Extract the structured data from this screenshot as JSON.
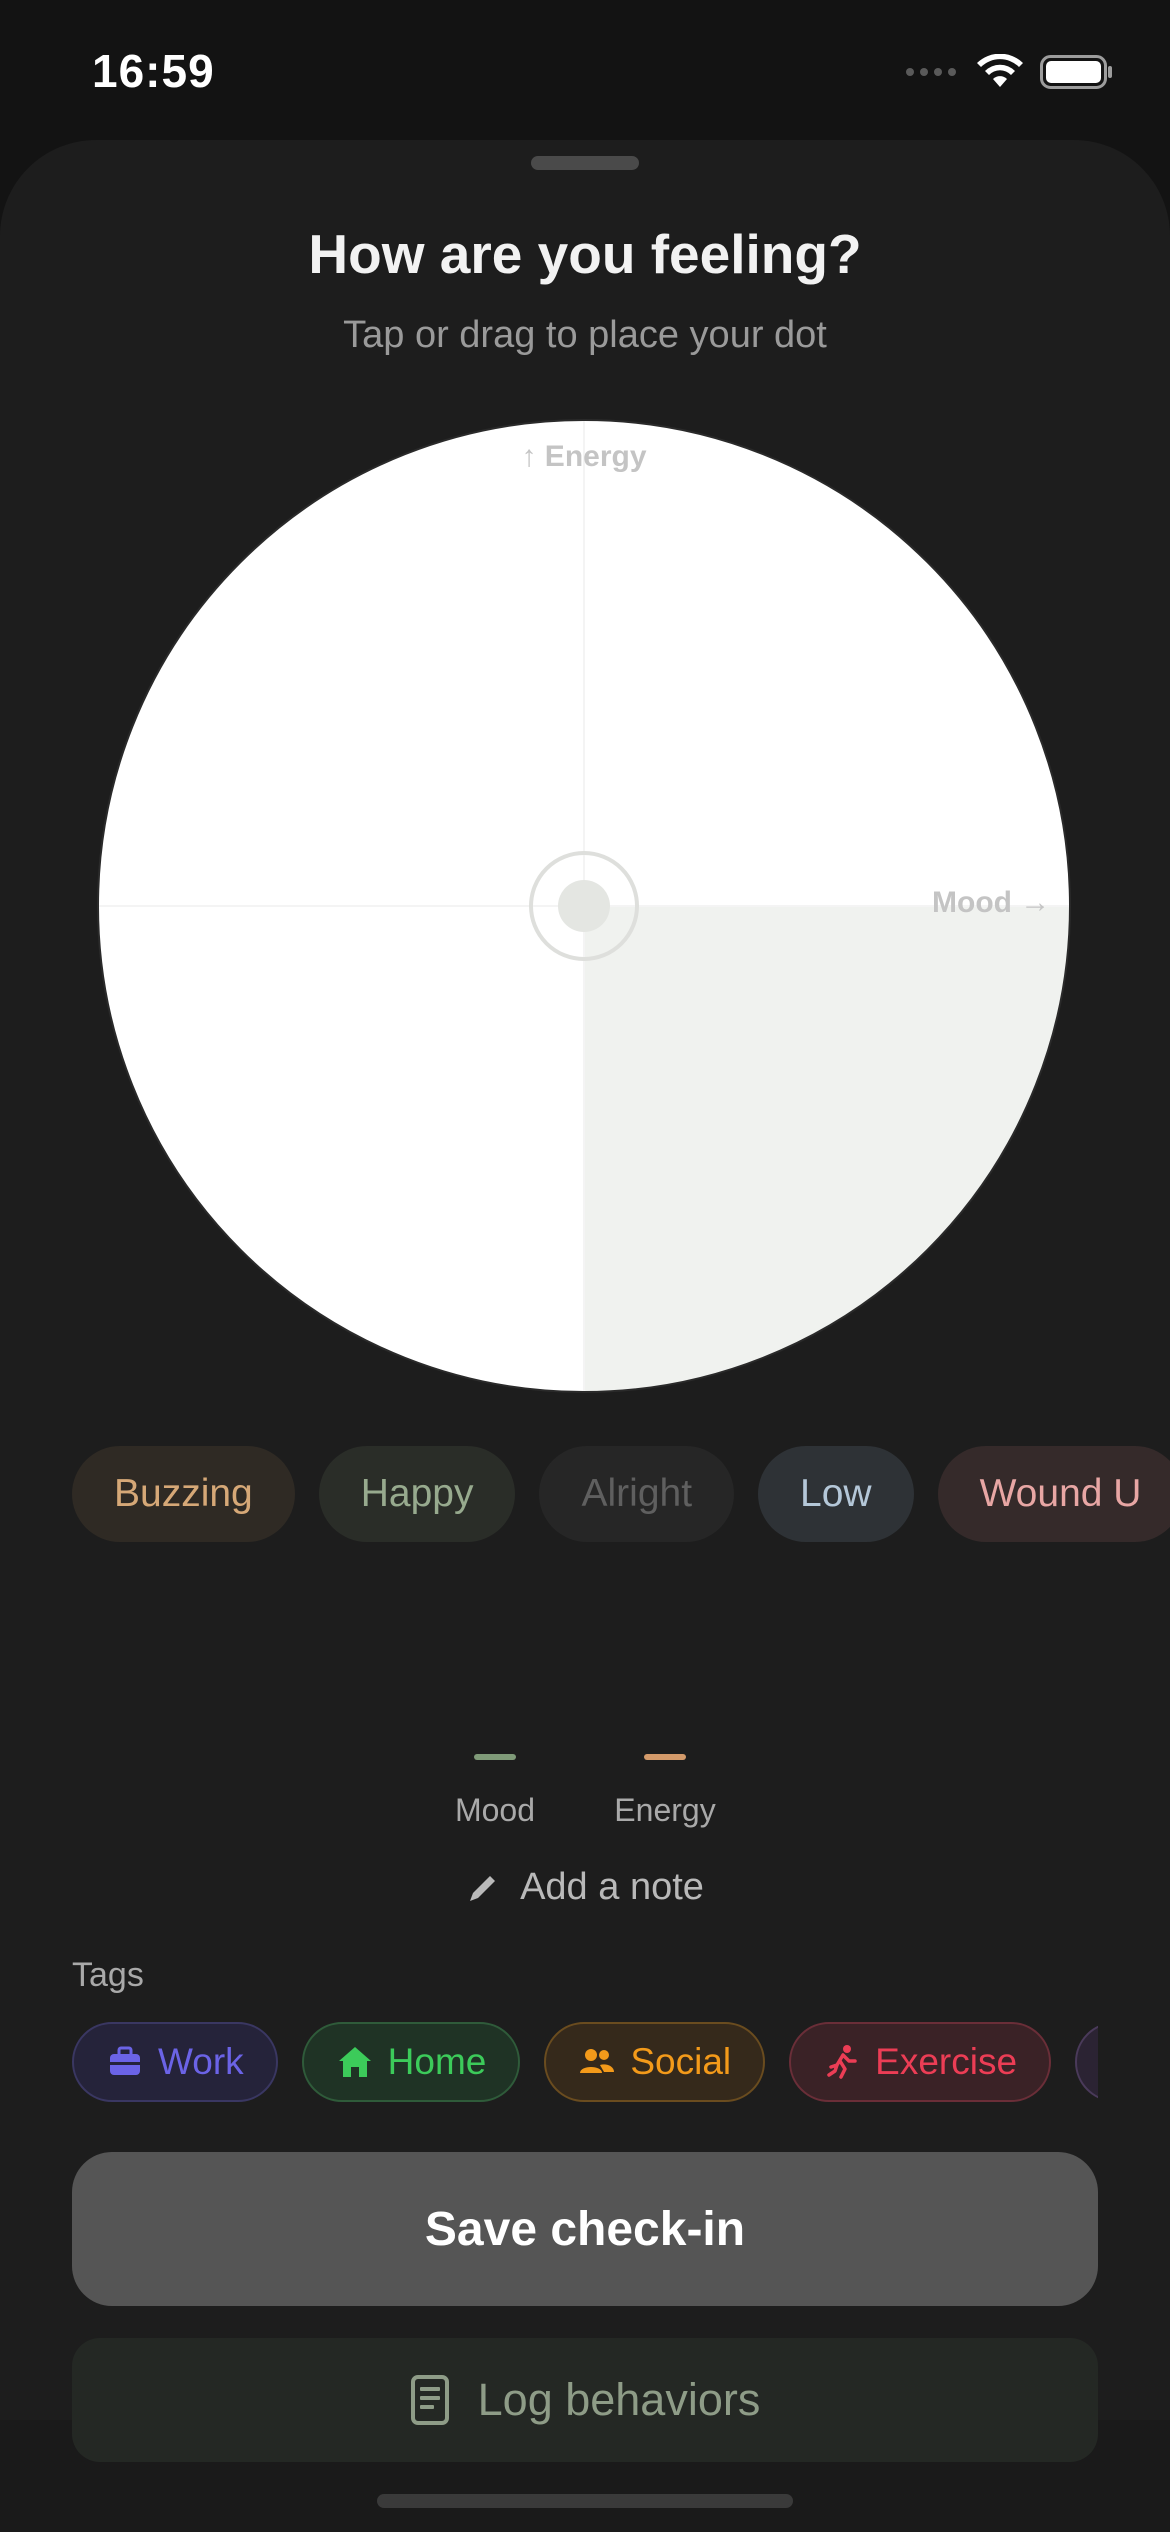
{
  "status_bar": {
    "time": "16:59"
  },
  "header": {
    "title": "How are you feeling?",
    "subtitle": "Tap or drag to place your dot"
  },
  "grid": {
    "energy_axis_label": "↑ Energy",
    "mood_axis_label": "Mood →"
  },
  "mood_chips": [
    {
      "label": "Buzzing"
    },
    {
      "label": "Happy"
    },
    {
      "label": "Alright"
    },
    {
      "label": "Low"
    },
    {
      "label": "Wound U"
    }
  ],
  "legend": {
    "mood_label": "Mood",
    "energy_label": "Energy",
    "mood_color": "#7f9a78",
    "energy_color": "#d39a6a"
  },
  "note": {
    "label": "Add a note"
  },
  "tags": {
    "title": "Tags",
    "items": [
      {
        "label": "Work",
        "icon": "briefcase-icon",
        "color": "#6b63e6"
      },
      {
        "label": "Home",
        "icon": "house-icon",
        "color": "#3ccb5a"
      },
      {
        "label": "Social",
        "icon": "people-icon",
        "color": "#f39a1a"
      },
      {
        "label": "Exercise",
        "icon": "running-icon",
        "color": "#ec3d55"
      }
    ]
  },
  "actions": {
    "save_label": "Save check-in",
    "log_label": "Log behaviors"
  }
}
